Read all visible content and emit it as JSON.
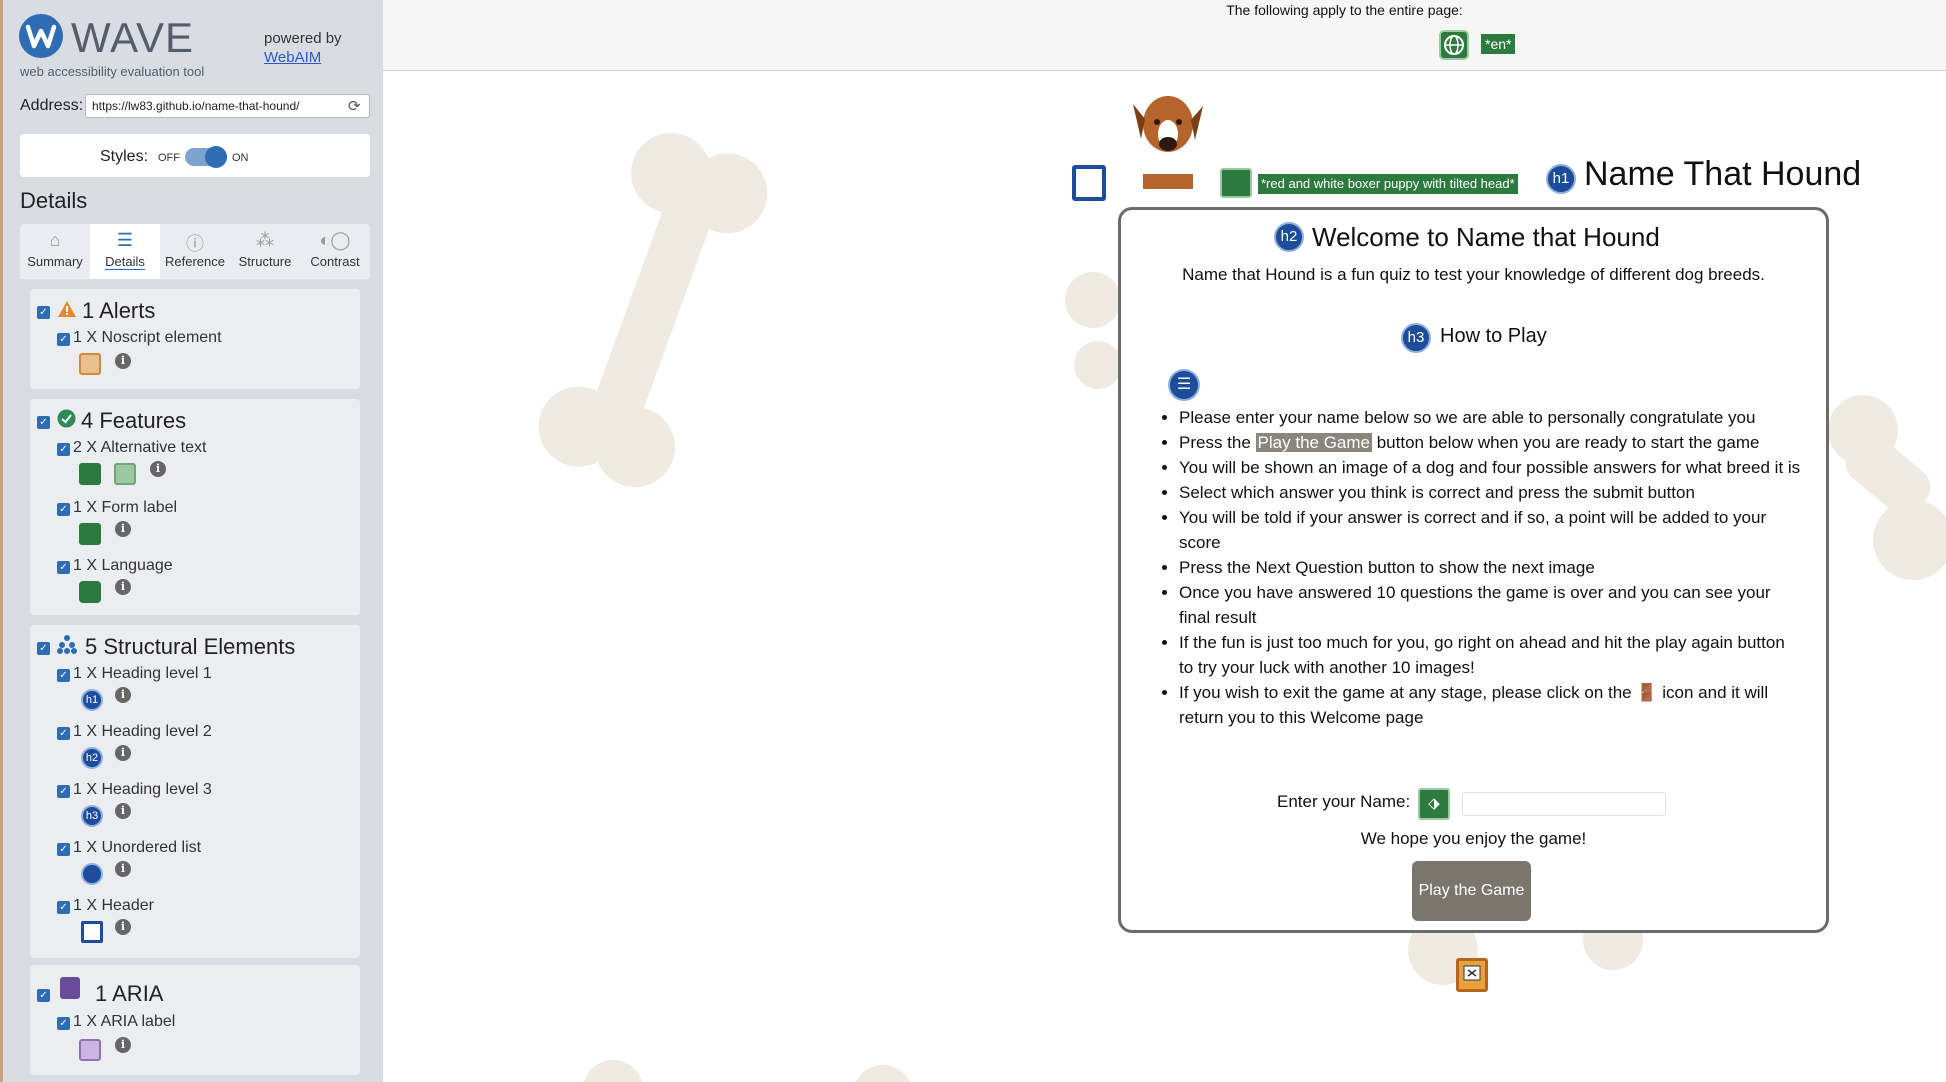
{
  "wave": {
    "logo_word": "WAVE",
    "tagline": "web accessibility evaluation tool",
    "powered_by": "powered by",
    "webaim_link": "WebAIM",
    "address_label": "Address:",
    "address_value": "https://lw83.github.io/name-that-hound/",
    "styles_label": "Styles:",
    "styles_off": "OFF",
    "styles_on": "ON",
    "details_heading": "Details",
    "tabs": [
      {
        "label": "Summary",
        "icon": "home-icon"
      },
      {
        "label": "Details",
        "icon": "list-icon"
      },
      {
        "label": "Reference",
        "icon": "info-icon"
      },
      {
        "label": "Structure",
        "icon": "structure-icon"
      },
      {
        "label": "Contrast",
        "icon": "contrast-icon"
      }
    ],
    "groups": {
      "alerts": {
        "title": "1 Alerts",
        "items": [
          "1 X Noscript element"
        ]
      },
      "features": {
        "title": "4 Features",
        "items": [
          "2 X Alternative text",
          "1 X Form label",
          "1 X Language"
        ]
      },
      "structural": {
        "title": "5 Structural Elements",
        "items": [
          "1 X Heading level 1",
          "1 X Heading level 2",
          "1 X Heading level 3",
          "1 X Unordered list",
          "1 X Header"
        ]
      },
      "aria": {
        "title": "1 ARIA",
        "items": [
          "1 X ARIA label"
        ]
      }
    },
    "badges": {
      "h1": "h1",
      "h2": "h2",
      "h3": "h3"
    },
    "colors": {
      "alert": "#e5892a",
      "feature": "#2e8b57",
      "structure": "#1d4c9a",
      "aria": "#6b4c9a"
    }
  },
  "page": {
    "top_note": "The following apply to the entire page:",
    "lang_badge": "*en*",
    "alt_text_badge": "*red and white boxer puppy with tilted head*",
    "site_title": "Name That Hound",
    "welcome_heading": "Welcome to Name that Hound",
    "intro": "Name that Hound is a fun quiz to test your knowledge of different dog breeds.",
    "how_heading": "How to Play",
    "instructions": [
      {
        "pre": "Please enter your name below so we are able to personally congratulate you",
        "hl": "",
        "post": ""
      },
      {
        "pre": "Press the ",
        "hl": "Play the Game",
        "post": " button below when you are ready to start the game"
      },
      {
        "pre": "You will be shown an image of a dog and four possible answers for what breed it is",
        "hl": "",
        "post": ""
      },
      {
        "pre": "Select which answer you think is correct and press the submit button",
        "hl": "",
        "post": ""
      },
      {
        "pre": "You will be told if your answer is correct and if so, a point will be added to your score",
        "hl": "",
        "post": ""
      },
      {
        "pre": "Press the Next Question button to show the next image",
        "hl": "",
        "post": ""
      },
      {
        "pre": "Once you have answered 10 questions the game is over and you can see your final result",
        "hl": "",
        "post": ""
      },
      {
        "pre": "If the fun is just too much for you, go right on ahead and hit the play again button to try your luck with another 10 images!",
        "hl": "",
        "post": ""
      },
      {
        "pre": "If you wish to exit the game at any stage, please click on the ",
        "hl": "",
        "post": " icon and it will return you to this Welcome page",
        "icon": "exit-door-icon"
      }
    ],
    "name_label": "Enter your Name:",
    "name_value": "",
    "enjoy_text": "We hope you enjoy the game!",
    "play_button": "Play the Game"
  }
}
